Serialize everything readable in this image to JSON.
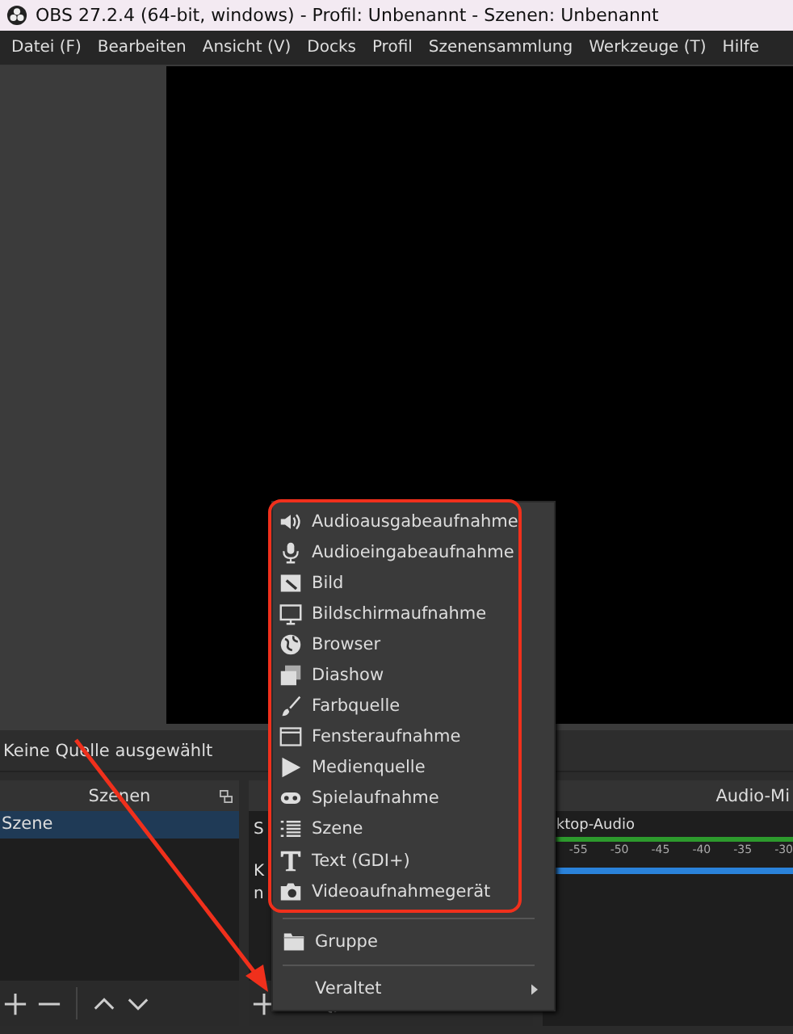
{
  "window": {
    "title": "OBS 27.2.4 (64-bit, windows) - Profil: Unbenannt - Szenen: Unbenannt"
  },
  "menu_bar": [
    "Datei (F)",
    "Bearbeiten",
    "Ansicht (V)",
    "Docks",
    "Profil",
    "Szenensammlung",
    "Werkzeuge (T)",
    "Hilfe"
  ],
  "status": "Keine Quelle ausgewählt",
  "scenes_dock": {
    "title": "Szenen",
    "items": [
      {
        "label": "Szene",
        "selected": true
      }
    ]
  },
  "sources_dock": {
    "texts": [
      "S",
      "K",
      "n"
    ]
  },
  "audio_mixer": {
    "title": "Audio-Mi",
    "track": "ktop-Audio",
    "ticks": [
      "-55",
      "-50",
      "-45",
      "-40",
      "-35",
      "-30"
    ],
    "volume": {
      "level": 1
    }
  },
  "context_menu": [
    {
      "kind": "source",
      "label": "Audioausgabeaufnahme"
    },
    {
      "kind": "source",
      "label": "Audioeingabeaufnahme"
    },
    {
      "kind": "source",
      "label": "Bild"
    },
    {
      "kind": "source",
      "label": "Bildschirmaufnahme"
    },
    {
      "kind": "source",
      "label": "Browser"
    },
    {
      "kind": "source",
      "label": "Diashow"
    },
    {
      "kind": "source",
      "label": "Farbquelle"
    },
    {
      "kind": "source",
      "label": "Fensteraufnahme"
    },
    {
      "kind": "source",
      "label": "Medienquelle"
    },
    {
      "kind": "source",
      "label": "Spielaufnahme"
    },
    {
      "kind": "source",
      "label": "Szene"
    },
    {
      "kind": "source",
      "label": "Text (GDI+)"
    },
    {
      "kind": "source",
      "label": "Videoaufnahmegerät"
    },
    {
      "kind": "group",
      "label": "Gruppe"
    },
    {
      "kind": "submenu",
      "label": "Veraltet"
    }
  ]
}
